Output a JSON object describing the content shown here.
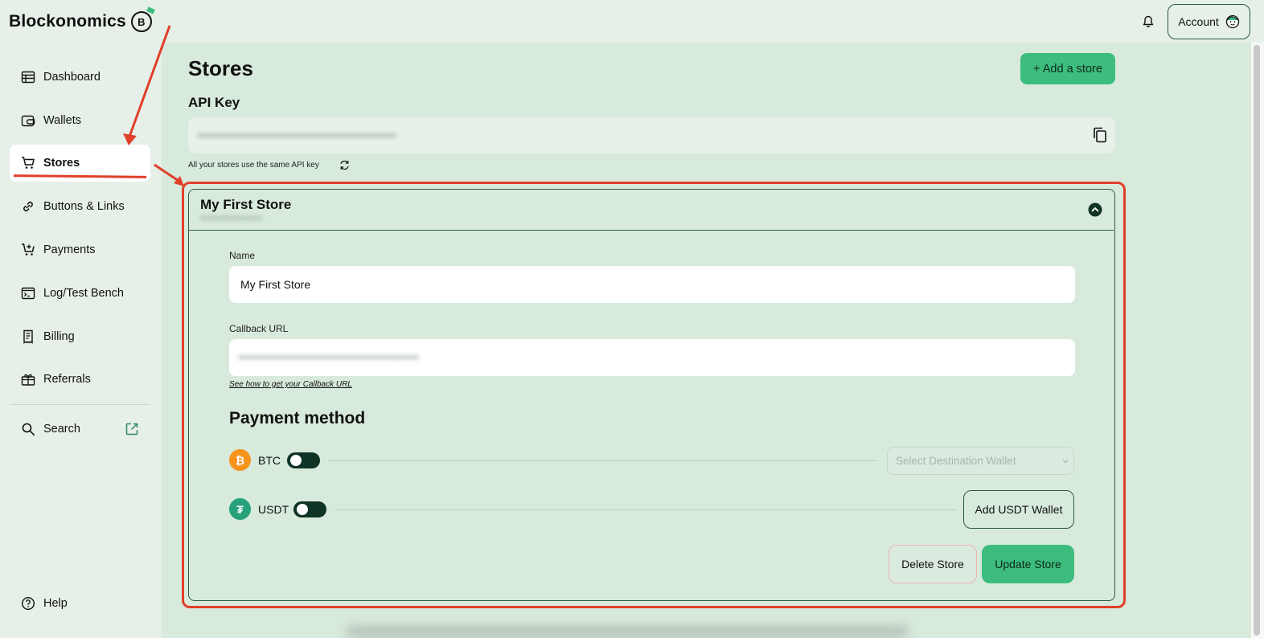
{
  "app": {
    "logo_text": "Blockonomics",
    "logo_mark": "B"
  },
  "header": {
    "account_label": "Account",
    "icons": [
      "bell-icon",
      "avatar-icon"
    ]
  },
  "sidebar": {
    "items": [
      {
        "label": "Dashboard",
        "icon": "table-icon"
      },
      {
        "label": "Wallets",
        "icon": "wallet-icon"
      },
      {
        "label": "Stores",
        "icon": "cart-icon",
        "active": true
      },
      {
        "label": "Buttons & Links",
        "icon": "link-icon"
      },
      {
        "label": "Payments",
        "icon": "cart-plus-icon"
      },
      {
        "label": "Log/Test Bench",
        "icon": "terminal-icon"
      },
      {
        "label": "Billing",
        "icon": "receipt-icon"
      },
      {
        "label": "Referrals",
        "icon": "gift-icon"
      }
    ],
    "search_label": "Search",
    "help_label": "Help"
  },
  "page": {
    "title": "Stores",
    "add_store_label": "+ Add a store",
    "api_key_label": "API Key",
    "api_key_value": "••••••••••••••••••••••••••••••••••••••••••",
    "api_key_note": "All your stores use the same API key"
  },
  "store": {
    "title": "My First Store",
    "subtitle": "••••••••••••••••",
    "name_label": "Name",
    "name_value": "My First Store",
    "callback_label": "Callback URL",
    "callback_value": "••••••••••••••••••••••••••••••••••••••",
    "callback_help": "See how to get your Callback URL",
    "payment_method_title": "Payment method",
    "methods": [
      {
        "label": "BTC",
        "icon": "bitcoin-icon",
        "color": "#f7931a",
        "enabled": false
      },
      {
        "label": "USDT",
        "icon": "tether-icon",
        "color": "#26a17b",
        "enabled": false
      }
    ],
    "select_wallet_placeholder": "Select Destination Wallet",
    "add_usdt_wallet_label": "Add USDT Wallet",
    "delete_label": "Delete Store",
    "update_label": "Update Store"
  },
  "colors": {
    "accent": "#3dbd7d",
    "annotation": "#e0402a",
    "dark_green": "#0f3324"
  }
}
